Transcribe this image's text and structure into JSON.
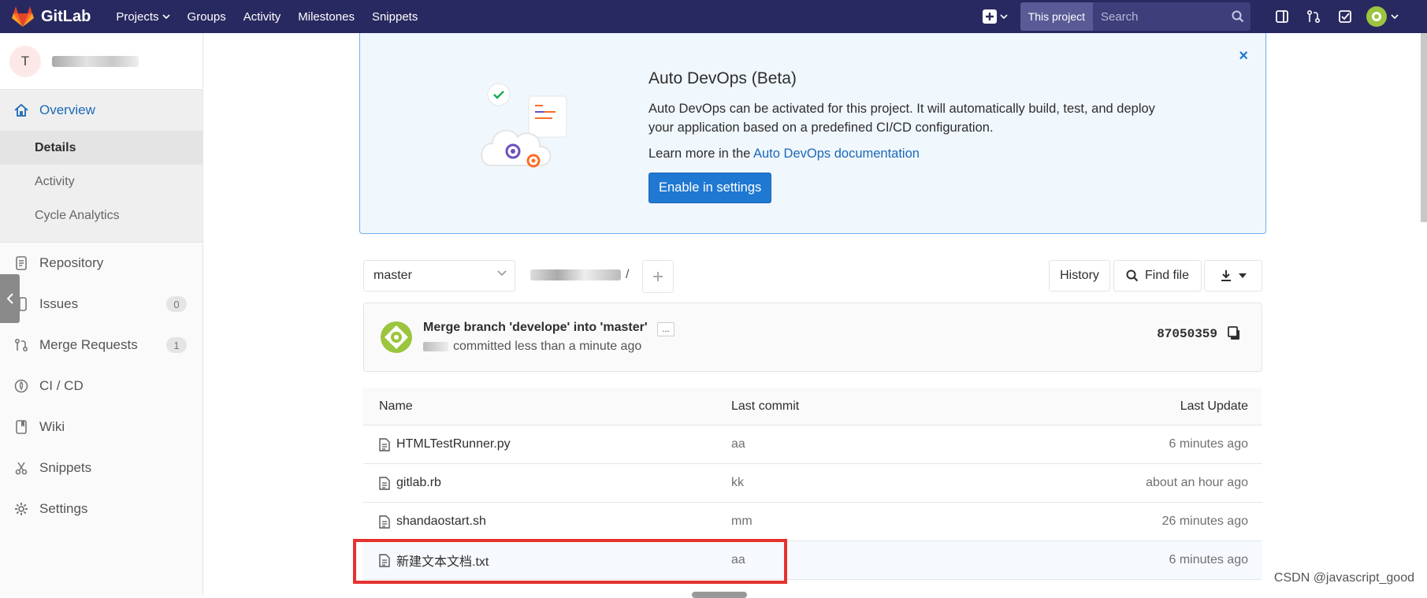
{
  "topnav": {
    "brand": "GitLab",
    "links": [
      "Projects",
      "Groups",
      "Activity",
      "Milestones",
      "Snippets"
    ],
    "search_scope": "This project",
    "search_placeholder": "Search"
  },
  "sidebar": {
    "project_initial": "T",
    "items": [
      {
        "label": "Overview",
        "icon": "home-icon"
      },
      {
        "label": "Repository",
        "icon": "doc-icon"
      },
      {
        "label": "Issues",
        "icon": "issues-icon",
        "badge": "0"
      },
      {
        "label": "Merge Requests",
        "icon": "merge-icon",
        "badge": "1"
      },
      {
        "label": "CI / CD",
        "icon": "rocket-icon"
      },
      {
        "label": "Wiki",
        "icon": "book-icon"
      },
      {
        "label": "Snippets",
        "icon": "scissors-icon"
      },
      {
        "label": "Settings",
        "icon": "gear-icon"
      }
    ],
    "overview_sub": [
      "Details",
      "Activity",
      "Cycle Analytics"
    ]
  },
  "devops": {
    "title": "Auto DevOps (Beta)",
    "text": "Auto DevOps can be activated for this project. It will automatically build, test, and deploy your application based on a predefined CI/CD configuration.",
    "learn_prefix": "Learn more in the ",
    "learn_link": "Auto DevOps documentation",
    "button": "Enable in settings",
    "close": "×"
  },
  "toolbar": {
    "branch": "master",
    "path_sep": "/",
    "history": "History",
    "find_file": "Find file"
  },
  "commit": {
    "title": "Merge branch 'develope' into 'master'",
    "more": "...",
    "sub": "committed less than a minute ago",
    "sha": "87050359"
  },
  "tree": {
    "headers": {
      "name": "Name",
      "commit": "Last commit",
      "date": "Last Update"
    },
    "rows": [
      {
        "name": "HTMLTestRunner.py",
        "commit": "aa",
        "date": "6 minutes ago"
      },
      {
        "name": "gitlab.rb",
        "commit": "kk",
        "date": "about an hour ago"
      },
      {
        "name": "shandaostart.sh",
        "commit": "mm",
        "date": "26 minutes ago"
      },
      {
        "name": "新建文本文档.txt",
        "commit": "aa",
        "date": "6 minutes ago"
      }
    ]
  },
  "watermark": "CSDN @javascript_good",
  "colors": {
    "nav": "#292961",
    "accent": "#1f78d1",
    "highlight": "#e5322e"
  }
}
